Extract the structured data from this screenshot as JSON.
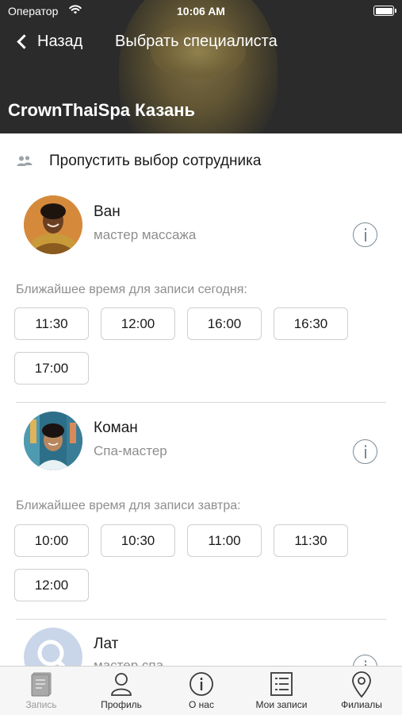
{
  "status_bar": {
    "carrier": "Оператор",
    "time": "10:06 AM"
  },
  "nav": {
    "back_label": "Назад",
    "title": "Выбрать специалиста"
  },
  "salon": {
    "name": "CrownThaiSpa Казань"
  },
  "skip": {
    "label": "Пропустить выбор сотрудника"
  },
  "staff": [
    {
      "name": "Ван",
      "role": "мастер массажа",
      "nearest_label": "Ближайшее время для записи сегодня:",
      "slots": [
        "11:30",
        "12:00",
        "16:00",
        "16:30",
        "17:00"
      ]
    },
    {
      "name": "Коман",
      "role": "Спа-мастер",
      "nearest_label": "Ближайшее время для записи завтра:",
      "slots": [
        "10:00",
        "10:30",
        "11:00",
        "11:30",
        "12:00"
      ]
    },
    {
      "name": "Лат",
      "role": "мастер спа"
    }
  ],
  "tabbar": {
    "items": [
      {
        "label": "Запись",
        "icon": "book-icon",
        "active": true
      },
      {
        "label": "Профиль",
        "icon": "person-icon",
        "active": false
      },
      {
        "label": "О нас",
        "icon": "info-icon",
        "active": false
      },
      {
        "label": "Мои записи",
        "icon": "list-icon",
        "active": false
      },
      {
        "label": "Филиалы",
        "icon": "map-pin-icon",
        "active": false
      }
    ]
  },
  "colors": {
    "header_bg": "#2b2b2b",
    "tabbar_bg": "#f6f6f6",
    "muted_text": "#8e8e8e",
    "slot_border": "#cfcfcf"
  }
}
